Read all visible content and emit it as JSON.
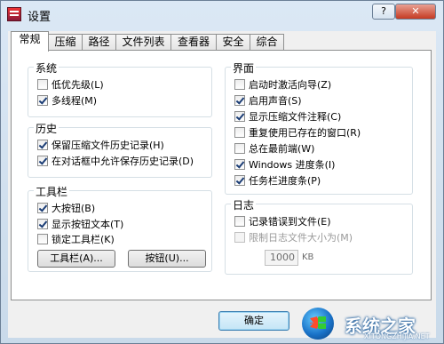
{
  "window": {
    "title": "设置",
    "help_label": "?",
    "close_label": "✕"
  },
  "tabs": [
    {
      "label": "常规"
    },
    {
      "label": "压缩"
    },
    {
      "label": "路径"
    },
    {
      "label": "文件列表"
    },
    {
      "label": "查看器"
    },
    {
      "label": "安全"
    },
    {
      "label": "综合"
    }
  ],
  "active_tab": "常规",
  "groups": {
    "system": {
      "title": "系统",
      "items": [
        {
          "label": "低优先级(L)",
          "checked": false
        },
        {
          "label": "多线程(M)",
          "checked": true
        }
      ]
    },
    "history": {
      "title": "历史",
      "items": [
        {
          "label": "保留压缩文件历史记录(H)",
          "checked": true
        },
        {
          "label": "在对话框中允许保存历史记录(D)",
          "checked": true
        }
      ]
    },
    "toolbar": {
      "title": "工具栏",
      "items": [
        {
          "label": "大按钮(B)",
          "checked": true
        },
        {
          "label": "显示按钮文本(T)",
          "checked": true
        },
        {
          "label": "锁定工具栏(K)",
          "checked": false
        }
      ],
      "toolbar_button_label": "工具栏(A)...",
      "buttons_button_label": "按钮(U)..."
    },
    "interface": {
      "title": "界面",
      "items": [
        {
          "label": "启动时激活向导(Z)",
          "checked": false
        },
        {
          "label": "启用声音(S)",
          "checked": true
        },
        {
          "label": "显示压缩文件注释(C)",
          "checked": true
        },
        {
          "label": "重复使用已存在的窗口(R)",
          "checked": false
        },
        {
          "label": "总在最前端(W)",
          "checked": false
        },
        {
          "label": "Windows 进度条(I)",
          "checked": true
        },
        {
          "label": "任务栏进度条(P)",
          "checked": true
        }
      ]
    },
    "log": {
      "title": "日志",
      "items": [
        {
          "label": "记录错误到文件(E)",
          "checked": false,
          "disabled": false
        },
        {
          "label": "限制日志文件大小为(M)",
          "checked": false,
          "disabled": true
        }
      ],
      "size_value": "1000",
      "size_unit": "KB"
    }
  },
  "footer": {
    "ok_label": "确定"
  },
  "watermark": {
    "text": "系统之家",
    "url": "XITONGZHIJIA.NET"
  }
}
